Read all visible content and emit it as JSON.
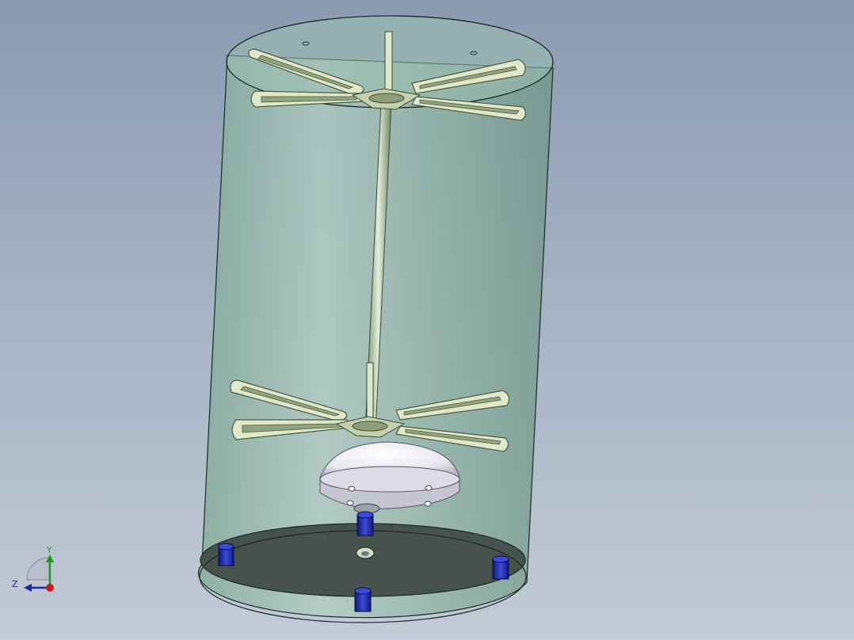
{
  "viewport": {
    "background_top": "#8a9bb0",
    "background_bottom": "#c2cbd6"
  },
  "model": {
    "tank_color": "#a4c8b4",
    "tank_edge_color": "#1a2a22",
    "floor_color": "#46524c",
    "shaft_color": "#c8dcc0",
    "impeller_color": "#dfe8c8",
    "dome_color": "#ffffff",
    "foot_color": "#1a2aa8"
  },
  "triad": {
    "y_label": "Y",
    "z_label": "Z",
    "y_color": "#1a9a1a",
    "z_color": "#1a2ab0",
    "x_color": "#d01818"
  }
}
